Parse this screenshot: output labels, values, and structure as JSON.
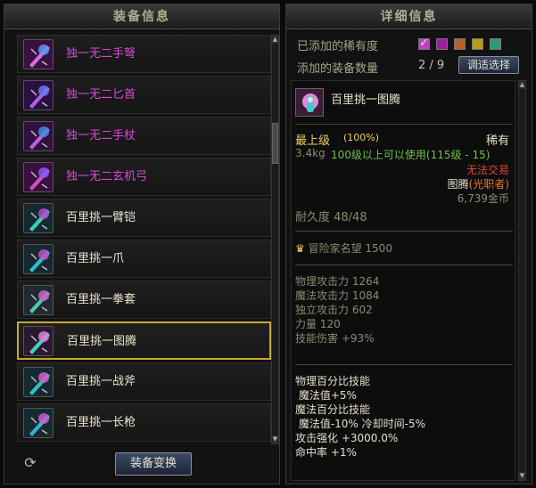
{
  "left_panel": {
    "title": "装备信息",
    "items": [
      {
        "name": "独一无二手弩",
        "rarity": "legendary",
        "icon": "crossbow-icon"
      },
      {
        "name": "独一无二匕首",
        "rarity": "legendary",
        "icon": "dagger-icon"
      },
      {
        "name": "独一无二手杖",
        "rarity": "legendary",
        "icon": "staff-icon"
      },
      {
        "name": "独一无二玄机弓",
        "rarity": "legendary",
        "icon": "bow-icon"
      },
      {
        "name": "百里挑一臂铠",
        "rarity": "set",
        "icon": "gauntlet-icon"
      },
      {
        "name": "百里挑一爪",
        "rarity": "set",
        "icon": "claw-icon"
      },
      {
        "name": "百里挑一拳套",
        "rarity": "set",
        "icon": "knuckle-icon"
      },
      {
        "name": "百里挑一图腾",
        "rarity": "set",
        "icon": "totem-icon",
        "selected": true
      },
      {
        "name": "百里挑一战斧",
        "rarity": "set",
        "icon": "axe-icon"
      },
      {
        "name": "百里挑一长枪",
        "rarity": "set",
        "icon": "spear-icon"
      }
    ],
    "swap_button": "装备变换",
    "refresh_icon": "refresh-icon"
  },
  "right_panel": {
    "title": "详细信息",
    "rarity_label": "已添加的稀有度",
    "rarity_swatches": [
      {
        "color": "#c040c0",
        "checked": true
      },
      {
        "color": "#9a1ea0",
        "checked": false
      },
      {
        "color": "#b8602a",
        "checked": false
      },
      {
        "color": "#b89a1a",
        "checked": false
      },
      {
        "color": "#2a9a7a",
        "checked": false
      }
    ],
    "count_label": "添加的装备数量",
    "count_value": "2 / 9",
    "adjust_button": "调适选择",
    "detail": {
      "item_name": "百里挑一图腾",
      "grade": "最上级",
      "grade_pct": "(100%)",
      "rarity": "稀有",
      "weight": "3.4kg",
      "level_req": "100级以上可以使用(115级 - 15)",
      "trade": "无法交易",
      "type": "图腾",
      "class_restriction": "(光职者)",
      "price": "6,739金币",
      "durability": "耐久度 48/48",
      "fame": "冒险家名望 1500",
      "stats": [
        "物理攻击力 1264",
        "魔法攻击力 1084",
        "独立攻击力 602",
        "力量 120",
        "技能伤害 +93%"
      ],
      "effects": [
        "物理百分比技能",
        " 魔法值+5%",
        "魔法百分比技能",
        " 魔法值-10% 冷却时间-5%",
        "攻击强化 +3000.0%",
        "命中率 +1%"
      ]
    }
  }
}
